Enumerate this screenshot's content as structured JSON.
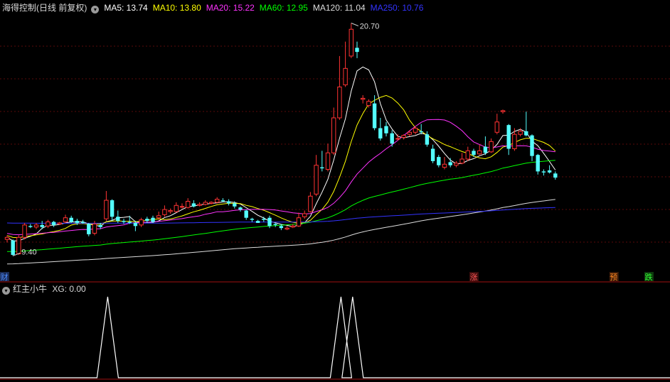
{
  "header": {
    "title": "海得控制(日线 前复权)",
    "ma": [
      {
        "label": "MA5: 13.74",
        "color": "#ffffff"
      },
      {
        "label": "MA10: 13.80",
        "color": "#ffff00"
      },
      {
        "label": "MA20: 15.22",
        "color": "#ff33ff"
      },
      {
        "label": "MA60: 12.95",
        "color": "#00ff00"
      },
      {
        "label": "MA120: 11.04",
        "color": "#dddddd"
      },
      {
        "label": "MA250: 10.76",
        "color": "#3333ff"
      }
    ]
  },
  "subpanel": {
    "title": "红主小牛",
    "value": "XG: 0.00"
  },
  "markers": [
    {
      "text": "财",
      "color": "#4d8cff",
      "bg": "#1a2a55",
      "pos": 0
    },
    {
      "text": "涨",
      "color": "#ff5555",
      "bg": "#3a0d0d",
      "pos": 80
    },
    {
      "text": "预",
      "color": "#ff8822",
      "bg": "#3a1a08",
      "pos": 104
    },
    {
      "text": "跌",
      "color": "#33ff33",
      "bg": "#0d3a0d",
      "pos": 110
    }
  ],
  "chart_data": {
    "type": "candlestick",
    "price_range": [
      9.0,
      21.2
    ],
    "annotations": [
      {
        "text": "20.70",
        "value": 20.7,
        "kind": "high"
      },
      {
        "text": "9.40",
        "value": 9.4,
        "kind": "low"
      }
    ],
    "candles": [
      [
        10.2,
        10.3,
        10.4,
        10.05
      ],
      [
        10.15,
        9.45,
        10.2,
        9.4
      ],
      [
        9.5,
        10.3,
        10.4,
        9.45
      ],
      [
        10.3,
        10.9,
        11.0,
        10.2
      ],
      [
        10.85,
        10.8,
        10.95,
        10.75
      ],
      [
        10.8,
        10.9,
        11.0,
        10.7
      ],
      [
        10.9,
        10.8,
        11.1,
        10.7
      ],
      [
        10.85,
        11.05,
        11.15,
        10.75
      ],
      [
        11.05,
        10.9,
        11.1,
        10.8
      ],
      [
        10.95,
        11.0,
        11.05,
        10.9
      ],
      [
        11.05,
        11.25,
        11.4,
        11.0
      ],
      [
        11.25,
        11.05,
        11.35,
        11.0
      ],
      [
        11.1,
        11.0,
        11.2,
        10.9
      ],
      [
        11.05,
        11.0,
        11.15,
        10.95
      ],
      [
        10.95,
        10.45,
        11.0,
        10.35
      ],
      [
        10.5,
        10.95,
        11.1,
        10.4
      ],
      [
        10.9,
        10.8,
        11.0,
        10.7
      ],
      [
        11.2,
        12.1,
        12.55,
        11.1
      ],
      [
        12.1,
        11.3,
        12.15,
        11.1
      ],
      [
        11.3,
        11.1,
        11.6,
        11.0
      ],
      [
        11.1,
        11.05,
        11.2,
        10.95
      ],
      [
        11.05,
        11.0,
        11.35,
        10.95
      ],
      [
        11.0,
        10.85,
        11.1,
        10.6
      ],
      [
        10.9,
        11.15,
        11.25,
        10.8
      ],
      [
        11.2,
        11.1,
        11.3,
        11.0
      ],
      [
        11.25,
        11.05,
        11.35,
        11.0
      ],
      [
        11.25,
        11.35,
        11.55,
        11.15
      ],
      [
        11.4,
        11.65,
        11.85,
        11.3
      ],
      [
        11.55,
        11.6,
        11.7,
        11.45
      ],
      [
        11.55,
        11.85,
        12.0,
        11.5
      ],
      [
        11.8,
        11.8,
        11.95,
        11.7
      ],
      [
        11.75,
        12.05,
        12.2,
        11.7
      ],
      [
        11.95,
        11.8,
        12.1,
        11.75
      ],
      [
        11.85,
        11.9,
        12.0,
        11.8
      ],
      [
        11.9,
        12.0,
        12.1,
        11.85
      ],
      [
        11.95,
        12.0,
        12.05,
        11.9
      ],
      [
        12.0,
        12.15,
        12.25,
        11.95
      ],
      [
        12.1,
        12.05,
        12.2,
        12.0
      ],
      [
        12.05,
        11.95,
        12.15,
        11.85
      ],
      [
        11.95,
        11.8,
        12.05,
        11.7
      ],
      [
        11.75,
        11.65,
        11.8,
        11.55
      ],
      [
        11.6,
        11.25,
        11.65,
        11.15
      ],
      [
        11.2,
        11.15,
        11.25,
        11.05
      ],
      [
        11.1,
        11.0,
        11.15,
        11.0
      ],
      [
        11.2,
        11.15,
        11.3,
        11.05
      ],
      [
        11.25,
        10.85,
        11.35,
        10.75
      ],
      [
        10.95,
        10.9,
        11.0,
        10.8
      ],
      [
        10.85,
        10.75,
        10.95,
        10.65
      ],
      [
        10.7,
        10.75,
        10.85,
        10.65
      ],
      [
        10.8,
        10.85,
        10.95,
        10.75
      ],
      [
        10.85,
        11.25,
        11.5,
        10.8
      ],
      [
        11.3,
        11.45,
        11.6,
        11.2
      ],
      [
        11.55,
        12.3,
        12.5,
        11.5
      ],
      [
        12.4,
        13.8,
        14.3,
        12.3
      ],
      [
        13.7,
        13.65,
        14.5,
        13.5
      ],
      [
        13.6,
        14.4,
        14.85,
        13.5
      ],
      [
        14.4,
        16.1,
        16.6,
        14.3
      ],
      [
        16.1,
        17.6,
        19.1,
        16.0
      ],
      [
        17.7,
        18.5,
        19.8,
        17.6
      ],
      [
        19.1,
        20.4,
        20.7,
        19.0
      ],
      [
        19.5,
        19.3,
        19.8,
        19.0
      ],
      [
        17.0,
        17.05,
        17.2,
        16.8
      ],
      [
        16.7,
        16.9,
        17.0,
        16.6
      ],
      [
        16.8,
        15.6,
        17.2,
        15.5
      ],
      [
        15.6,
        15.1,
        16.1,
        15.0
      ],
      [
        15.7,
        15.35,
        15.9,
        15.2
      ],
      [
        15.35,
        14.85,
        15.5,
        14.7
      ],
      [
        15.1,
        15.1,
        15.3,
        15.0
      ],
      [
        15.15,
        15.25,
        15.3,
        15.05
      ],
      [
        15.3,
        15.4,
        15.5,
        15.2
      ],
      [
        15.4,
        15.6,
        15.7,
        15.3
      ],
      [
        15.45,
        15.4,
        15.8,
        15.3
      ],
      [
        15.3,
        14.8,
        15.45,
        14.7
      ],
      [
        14.6,
        14.0,
        14.8,
        13.9
      ],
      [
        14.2,
        13.8,
        14.3,
        13.7
      ],
      [
        13.7,
        13.85,
        14.2,
        13.6
      ],
      [
        13.95,
        13.8,
        14.15,
        13.7
      ],
      [
        13.8,
        13.9,
        14.0,
        13.7
      ],
      [
        13.9,
        14.1,
        14.4,
        13.85
      ],
      [
        14.1,
        14.5,
        14.7,
        14.0
      ],
      [
        14.5,
        14.3,
        14.6,
        14.2
      ],
      [
        14.35,
        14.5,
        14.8,
        14.3
      ],
      [
        14.7,
        14.4,
        15.2,
        14.3
      ],
      [
        14.45,
        14.95,
        15.1,
        14.4
      ],
      [
        15.4,
        15.9,
        16.3,
        15.3
      ],
      [
        16.4,
        16.45,
        16.5,
        16.3
      ],
      [
        15.75,
        14.6,
        15.8,
        14.3
      ],
      [
        14.6,
        15.3,
        15.6,
        14.5
      ],
      [
        15.3,
        15.45,
        15.6,
        15.2
      ],
      [
        15.45,
        15.25,
        16.4,
        15.2
      ],
      [
        15.25,
        14.25,
        15.3,
        14.0
      ],
      [
        14.3,
        13.5,
        14.35,
        13.35
      ],
      [
        13.5,
        13.45,
        13.6,
        13.3
      ],
      [
        13.55,
        13.45,
        13.8,
        13.4
      ],
      [
        13.4,
        13.2,
        13.5,
        13.1
      ]
    ],
    "indicator": {
      "name": "XG",
      "range": [
        0,
        1
      ],
      "peaks_at_candle_index": [
        17,
        57,
        59
      ]
    }
  }
}
